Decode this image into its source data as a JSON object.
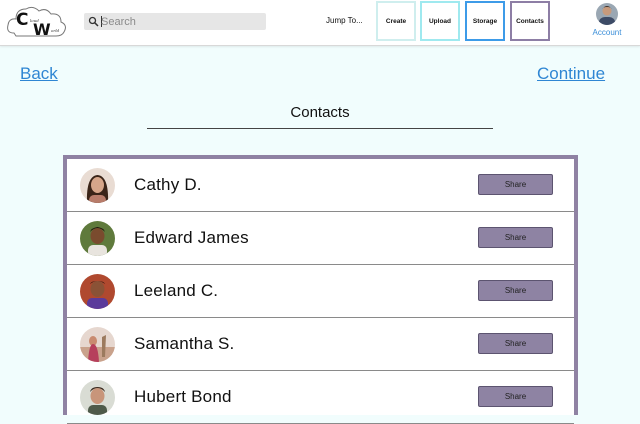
{
  "header": {
    "logo_text": "Cloud World",
    "search": {
      "placeholder": "Search",
      "value": ""
    },
    "jump_label": "Jump To...",
    "nav": {
      "create": "Create",
      "upload": "Upload",
      "storage": "Storage",
      "contacts": "Contacts"
    },
    "account_label": "Account"
  },
  "links": {
    "back": "Back",
    "continue": "Continue"
  },
  "page_title": "Contacts",
  "contacts": [
    {
      "name": "Cathy D.",
      "share_label": "Share"
    },
    {
      "name": "Edward James",
      "share_label": "Share"
    },
    {
      "name": "Leeland C.",
      "share_label": "Share"
    },
    {
      "name": "Samantha S.",
      "share_label": "Share"
    },
    {
      "name": "Hubert Bond",
      "share_label": "Share"
    }
  ],
  "colors": {
    "background": "#f1fdfd",
    "link": "#2f86d3",
    "share_button": "#8e83a3",
    "list_border": "#8f82a3"
  }
}
